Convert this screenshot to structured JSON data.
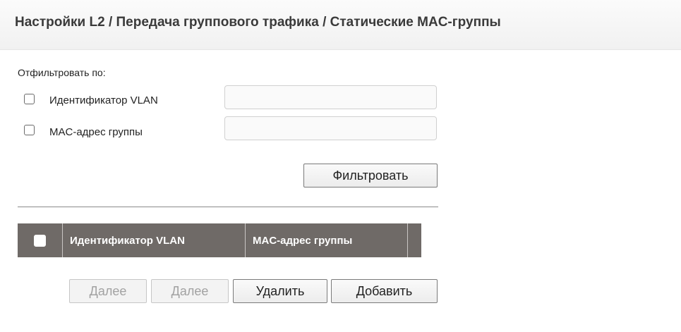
{
  "header": {
    "title": "Настройки L2 / Передача группового трафика / Статические MAC-группы"
  },
  "filter": {
    "label": "Отфильтровать по:",
    "vlan_label": "Идентификатор VLAN",
    "vlan_value": "",
    "mac_label": "MAC-адрес группы",
    "mac_value": "",
    "filter_button": "Фильтровать"
  },
  "table": {
    "columns": [
      "Идентификатор VLAN",
      "MAC-адрес группы"
    ],
    "rows": []
  },
  "actions": {
    "prev_button": "Далее",
    "next_button": "Далее",
    "delete_button": "Удалить",
    "add_button": "Добавить"
  }
}
